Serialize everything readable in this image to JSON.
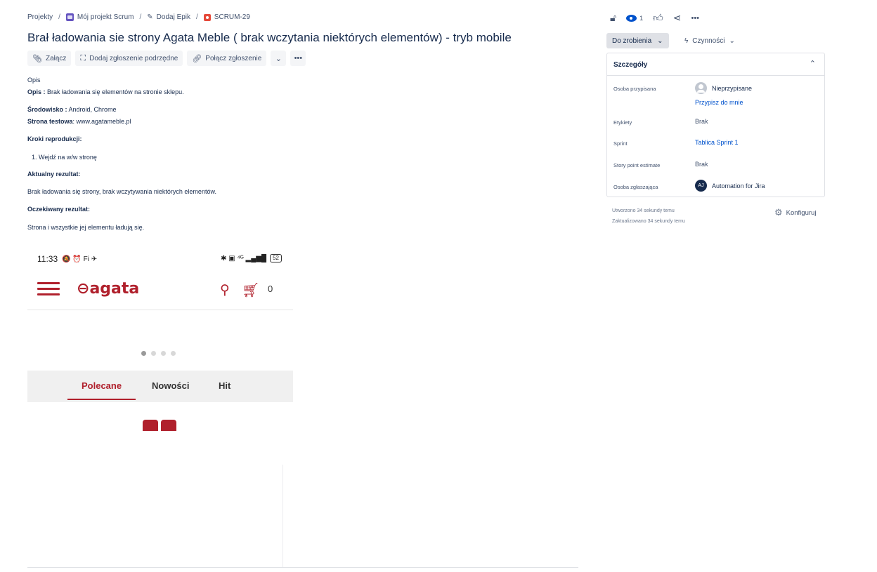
{
  "breadcrumb": {
    "projects": "Projekty",
    "project": "Mój projekt Scrum",
    "epic": "Dodaj Epik",
    "issue_key": "SCRUM-29"
  },
  "issue": {
    "title": "Brał ładowania sie strony Agata Meble ( brak wczytania niektórych elementów) - tryb mobile"
  },
  "toolbar": {
    "attach": "Załącz",
    "add_child": "Dodaj zgłoszenie podrzędne",
    "link_issue": "Połącz zgłoszenie"
  },
  "description": {
    "heading": "Opis",
    "opis_label": "Opis :",
    "opis_text": " Brak ładowania się elementów na stronie sklepu.",
    "env_label": "Środowisko :",
    "env_text": " Android, Chrome",
    "site_label": "Strona testowa",
    "site_text": ": www.agatameble.pl",
    "steps_label": "Kroki reprodukcji:",
    "step_1": "1.  Wejdź na w/w stronę",
    "actual_label": "Aktualny rezultat:",
    "actual_text": "Brak ładowania się strony,  brak wczytywania niektórych elementów.",
    "expected_label": "Oczekiwany rezultat:",
    "expected_text": "Strona i wszystkie jej elementu ładują się."
  },
  "attachment": {
    "time": "11:33",
    "status_icons": "🔕 ⏰ Fi ✈",
    "right_icons": "✱ ▣ ⁴ᴳ ▂▄▆█",
    "battery": "52",
    "logo": "agata",
    "cart_count": "0",
    "tabs": [
      "Polecane",
      "Nowości",
      "Hit"
    ],
    "active_tab": "Polecane",
    "brand_color": "#b0202c"
  },
  "header_actions": {
    "watchers": "1"
  },
  "status": {
    "label": "Do zrobienia",
    "actions_label": "Czynności"
  },
  "details": {
    "title": "Szczegóły",
    "assignee_label": "Osoba przypisana",
    "assignee_value": "Nieprzypisane",
    "assign_me": "Przypisz do mnie",
    "labels_label": "Etykiety",
    "labels_value": "Brak",
    "sprint_label": "Sprint",
    "sprint_value": "Tablica Sprint 1",
    "sp_label": "Story point estimate",
    "sp_value": "Brak",
    "reporter_label": "Osoba zgłaszająca",
    "reporter_initials": "AJ",
    "reporter_value": "Automation for Jira"
  },
  "meta": {
    "created": "Utworzono 34 sekundy temu",
    "updated": "Zaktualizowano 34 sekundy temu",
    "configure": "Konfiguruj"
  }
}
